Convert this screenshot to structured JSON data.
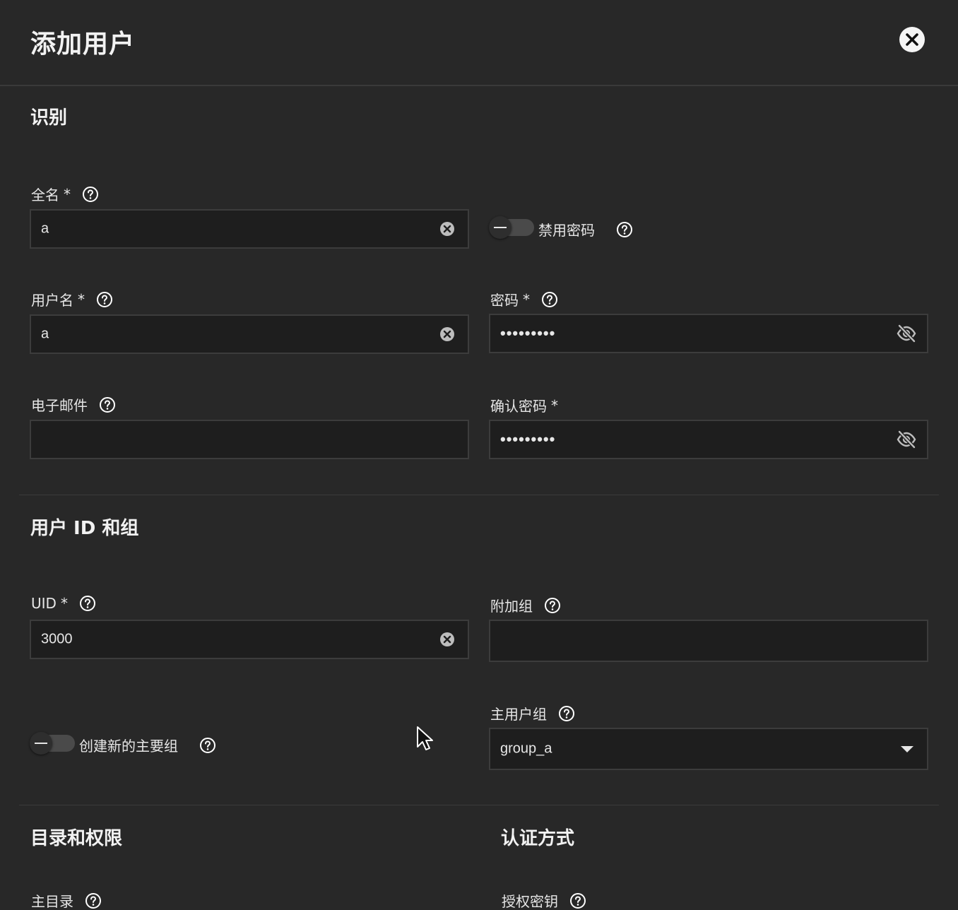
{
  "dialog": {
    "title": "添加用户"
  },
  "identification": {
    "section_title": "识别",
    "full_name": {
      "label": "全名",
      "required": "*",
      "value": "a"
    },
    "disable_password": {
      "label": "禁用密码",
      "enabled": false
    },
    "username": {
      "label": "用户名",
      "required": "*",
      "value": "a"
    },
    "password": {
      "label": "密码",
      "required": "*",
      "value": "•••••••••"
    },
    "email": {
      "label": "电子邮件",
      "value": ""
    },
    "confirm_password": {
      "label": "确认密码",
      "required": "*",
      "value": "•••••••••"
    }
  },
  "user_id_groups": {
    "section_title": "用户 ID 和组",
    "uid": {
      "label": "UID",
      "required": "*",
      "value": "3000"
    },
    "aux_groups": {
      "label": "附加组",
      "value": ""
    },
    "create_primary_group": {
      "label": "创建新的主要组",
      "enabled": false
    },
    "primary_group": {
      "label": "主用户组",
      "value": "group_a"
    }
  },
  "directories": {
    "section_title": "目录和权限",
    "home_dir": {
      "label": "主目录"
    }
  },
  "authentication": {
    "section_title": "认证方式",
    "authorized_keys": {
      "label": "授权密钥"
    }
  },
  "icons": {
    "close": "close-icon",
    "help": "help-circle-icon",
    "clear": "clear-circle-icon",
    "visibility_off": "eye-off-icon",
    "dropdown": "caret-down-icon"
  },
  "colors": {
    "background": "#282828",
    "field_background": "#1e1e1e",
    "field_border": "#3c3c3c",
    "text": "#e6e6e6"
  }
}
